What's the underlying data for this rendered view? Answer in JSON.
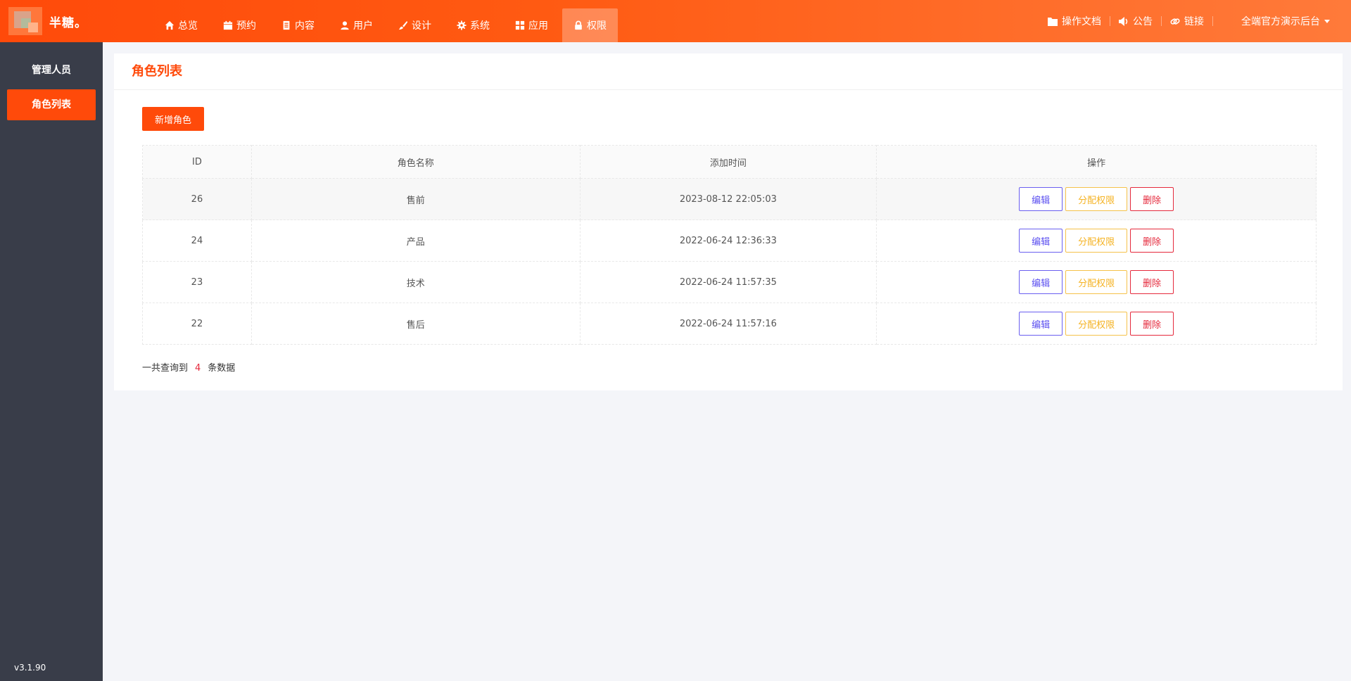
{
  "brand": {
    "name": "半糖。"
  },
  "nav": [
    {
      "label": "总览",
      "icon": "home-icon"
    },
    {
      "label": "预约",
      "icon": "calendar-icon"
    },
    {
      "label": "内容",
      "icon": "document-icon"
    },
    {
      "label": "用户",
      "icon": "user-icon"
    },
    {
      "label": "设计",
      "icon": "brush-icon"
    },
    {
      "label": "系统",
      "icon": "gear-icon"
    },
    {
      "label": "应用",
      "icon": "grid-icon"
    },
    {
      "label": "权限",
      "icon": "lock-icon",
      "active": true
    }
  ],
  "top_links": {
    "docs": "操作文档",
    "notice": "公告",
    "link": "链接",
    "user": "全端官方演示后台"
  },
  "sidebar": {
    "items": [
      {
        "label": "管理人员"
      },
      {
        "label": "角色列表",
        "active": true
      }
    ],
    "version": "v3.1.90"
  },
  "page": {
    "title": "角色列表",
    "add_button": "新增角色"
  },
  "table": {
    "headers": [
      "ID",
      "角色名称",
      "添加时间",
      "操作"
    ],
    "rows": [
      {
        "id": "26",
        "name": "售前",
        "time": "2023-08-12 22:05:03"
      },
      {
        "id": "24",
        "name": "产品",
        "time": "2022-06-24 12:36:33"
      },
      {
        "id": "23",
        "name": "技术",
        "time": "2022-06-24 11:57:35"
      },
      {
        "id": "22",
        "name": "售后",
        "time": "2022-06-24 11:57:16"
      }
    ],
    "actions": {
      "edit": "编辑",
      "assign": "分配权限",
      "delete": "删除"
    }
  },
  "summary": {
    "prefix": "一共查询到",
    "count": "4",
    "suffix": "条数据"
  },
  "colors": {
    "accent": "#ff4a0a",
    "sidebar": "#393d49",
    "edit": "#5b4ff0",
    "assign": "#f5b324",
    "delete": "#e5293c"
  }
}
